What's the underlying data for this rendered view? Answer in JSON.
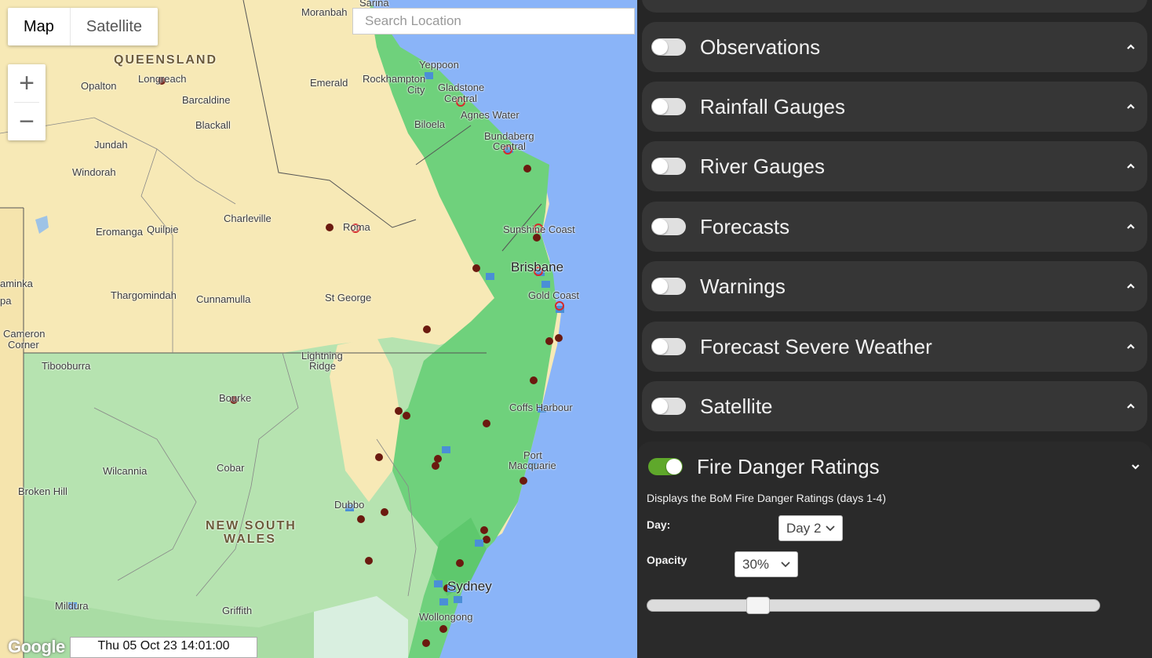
{
  "map": {
    "map_type_buttons": [
      "Map",
      "Satellite"
    ],
    "active_map_type": "Map",
    "zoom_in": "+",
    "zoom_out": "−",
    "search_placeholder": "Search Location",
    "google_logo": "Google",
    "timestamp": "Thu 05 Oct 23 14:01:00",
    "labels": {
      "sarina": "Sarina",
      "moranbah": "Moranbah",
      "queensland": "QUEENSLAND",
      "opalton": "Opalton",
      "longreach": "Longreach",
      "barcaldine": "Barcaldine",
      "emerald": "Emerald",
      "rockhampton": "Rockhampton",
      "yeppoon": "Yeppoon",
      "city": "City",
      "gladstone": "Gladstone",
      "central1": "Central",
      "blackall": "Blackall",
      "agnes_water": "Agnes Water",
      "biloela": "Biloela",
      "bundaberg": "Bundaberg",
      "central2": "Central",
      "jundah": "Jundah",
      "windorah": "Windorah",
      "charleville": "Charleville",
      "roma": "Roma",
      "eromanga": "Eromanga",
      "quilpie": "Quilpie",
      "sunshine_coast": "Sunshine Coast",
      "brisbane": "Brisbane",
      "gold_coast": "Gold Coast",
      "aminka": "aminka",
      "pa": "pa",
      "thargomindah": "Thargomindah",
      "cunnamulla": "Cunnamulla",
      "st_george": "St George",
      "cameron_corner1": "Cameron",
      "cameron_corner2": "Corner",
      "lightning_ridge1": "Lightning",
      "lightning_ridge2": "Ridge",
      "tibooburra": "Tibooburra",
      "bourke": "Bourke",
      "coffs_harbour": "Coffs Harbour",
      "port": "Port",
      "macquarie": "Macquarie",
      "wilcannia": "Wilcannia",
      "cobar": "Cobar",
      "broken_hill": "Broken Hill",
      "dubbo": "Dubbo",
      "nsw1": "NEW SOUTH",
      "nsw2": "WALES",
      "sydney": "Sydney",
      "mildura": "Mildura",
      "griffith": "Griffith",
      "wollongong": "Wollongong"
    },
    "fire_danger_colors": {
      "moderate": "#b6e3b0",
      "high": "#6fd17c",
      "extreme": "#f7e6a5",
      "none": "#f7e9b6"
    },
    "marker_colors": {
      "fire": "#6b1a0f",
      "rain_gauge": "#4a8fd6",
      "warning": "#d62a2a"
    }
  },
  "panel": {
    "layers": [
      {
        "title": "Observations",
        "enabled": false
      },
      {
        "title": "Rainfall Gauges",
        "enabled": false
      },
      {
        "title": "River Gauges",
        "enabled": false
      },
      {
        "title": "Forecasts",
        "enabled": false
      },
      {
        "title": "Warnings",
        "enabled": false
      },
      {
        "title": "Forecast Severe Weather",
        "enabled": false
      },
      {
        "title": "Satellite",
        "enabled": false
      }
    ],
    "fire_danger": {
      "title": "Fire Danger Ratings",
      "enabled": true,
      "description": "Displays the BoM Fire Danger Ratings (days 1-4)",
      "day_label": "Day:",
      "day_value": "Day 2",
      "opacity_label": "Opacity",
      "opacity_value": "30%",
      "slider_fraction": 0.23
    }
  }
}
